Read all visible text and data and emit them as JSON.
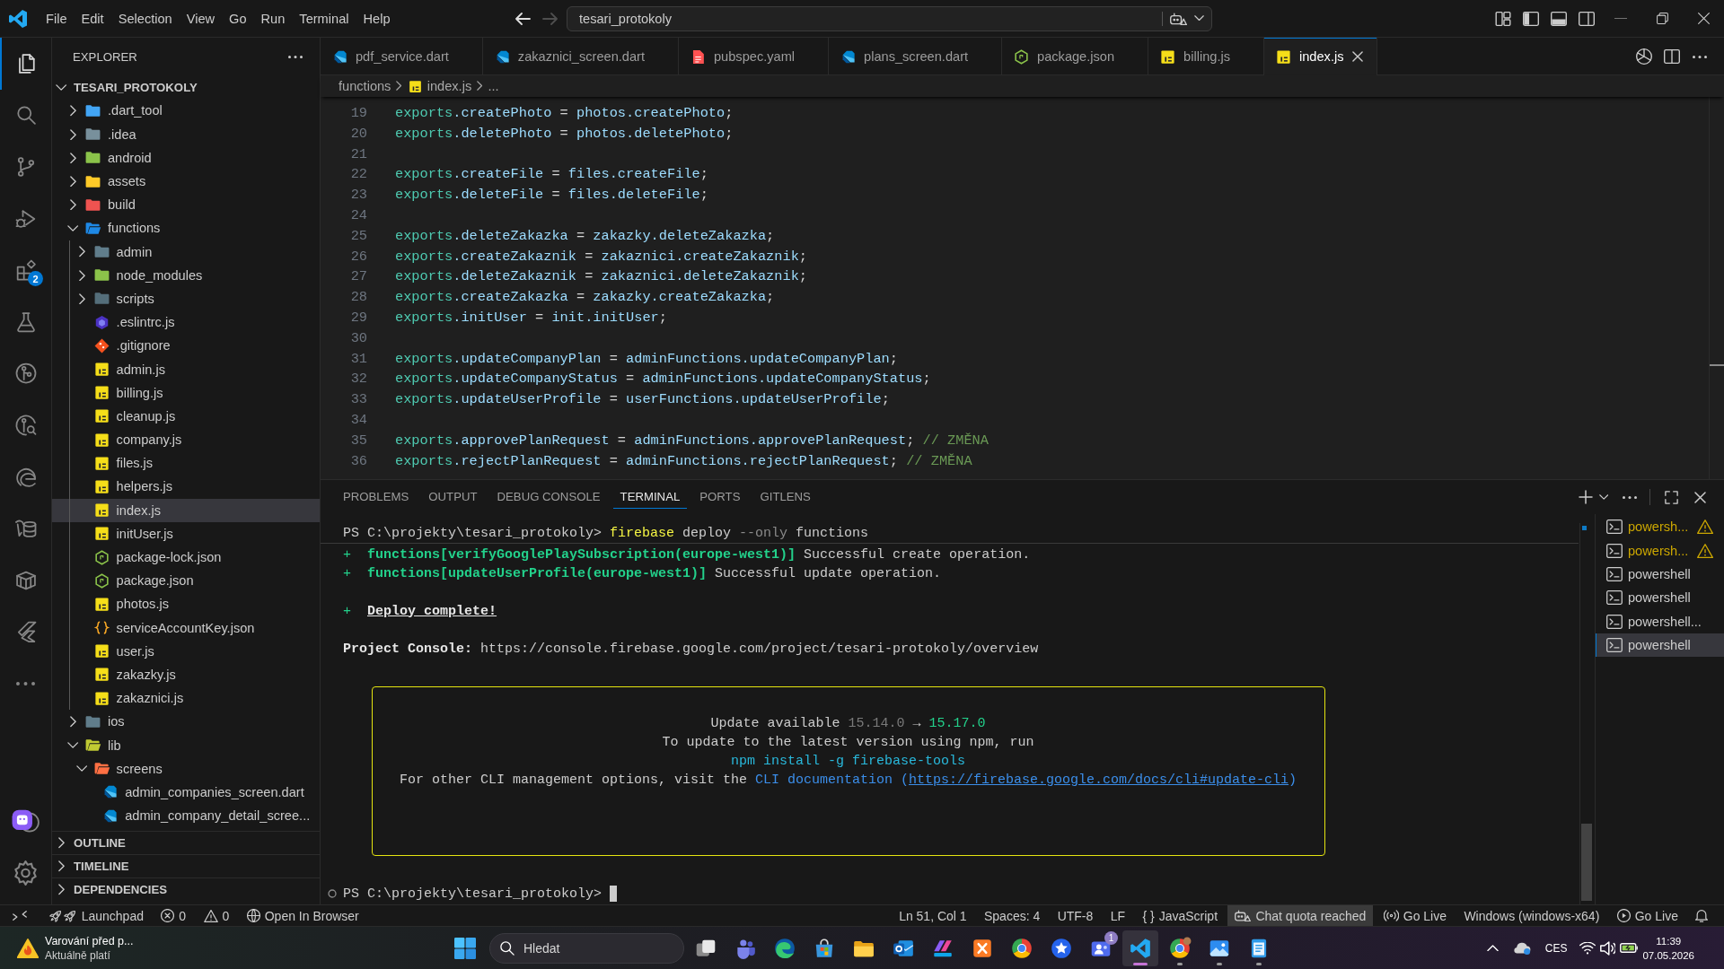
{
  "window": {
    "menu": [
      "File",
      "Edit",
      "Selection",
      "View",
      "Go",
      "Run",
      "Terminal",
      "Help"
    ],
    "navigation": [
      {
        "disabled": false
      },
      {
        "disabled": true
      }
    ],
    "command_center": {
      "label": "tesari_protokoly"
    },
    "layout_controls": [
      {
        "kind": "customize"
      },
      {
        "kind": "primary-sidebar",
        "on": true
      },
      {
        "kind": "panel",
        "on": true
      },
      {
        "kind": "secondary-sidebar",
        "on": false
      }
    ]
  },
  "activity_bar": {
    "items": [
      {
        "selected": true
      },
      {
        "selected": false
      },
      {
        "selected": false
      },
      {
        "selected": false
      },
      {
        "selected": false,
        "badge": "2"
      },
      {
        "selected": false
      },
      {
        "selected": false
      },
      {
        "selected": false
      },
      {
        "selected": false
      },
      {
        "selected": false
      },
      {
        "selected": false
      },
      {
        "selected": false
      },
      {
        "selected": false
      }
    ]
  },
  "explorer": {
    "title": "EXPLORER",
    "root": {
      "label": "TESARI_PROTOKOLY",
      "expanded": true
    },
    "items": [
      {
        "label": ".dart_tool",
        "kind": "folder",
        "color": "#42a5f5",
        "expanded": false,
        "selected": false
      },
      {
        "label": ".idea",
        "kind": "folder",
        "color": "#78909c",
        "expanded": false,
        "selected": false
      },
      {
        "label": "android",
        "kind": "folder",
        "color": "#8bc34a",
        "expanded": false,
        "selected": false
      },
      {
        "label": "assets",
        "kind": "folder",
        "color": "#ffca28",
        "expanded": false,
        "selected": false
      },
      {
        "label": "build",
        "kind": "folder",
        "color": "#ef5350",
        "expanded": false,
        "selected": false
      },
      {
        "label": "functions",
        "kind": "folder",
        "color": "#1e88e5",
        "expanded": true,
        "selected": false,
        "children": [
          {
            "label": "admin",
            "kind": "folder",
            "color": "#607d8b",
            "expanded": false,
            "selected": false
          },
          {
            "label": "node_modules",
            "kind": "folder",
            "color": "#8bc34a",
            "expanded": false,
            "selected": false
          },
          {
            "label": "scripts",
            "kind": "folder",
            "color": "#546e7a",
            "expanded": false,
            "selected": false
          },
          {
            "label": ".eslintrc.js",
            "kind": "eslint",
            "selected": false
          },
          {
            "label": ".gitignore",
            "kind": "git",
            "selected": false
          },
          {
            "label": "admin.js",
            "kind": "js",
            "selected": false
          },
          {
            "label": "billing.js",
            "kind": "js",
            "selected": false
          },
          {
            "label": "cleanup.js",
            "kind": "js",
            "selected": false
          },
          {
            "label": "company.js",
            "kind": "js",
            "selected": false
          },
          {
            "label": "files.js",
            "kind": "js",
            "selected": false
          },
          {
            "label": "helpers.js",
            "kind": "js",
            "selected": false
          },
          {
            "label": "index.js",
            "kind": "js",
            "selected": true
          },
          {
            "label": "initUser.js",
            "kind": "js",
            "selected": false
          },
          {
            "label": "package-lock.json",
            "kind": "npm",
            "selected": false
          },
          {
            "label": "package.json",
            "kind": "npm",
            "selected": false
          },
          {
            "label": "photos.js",
            "kind": "js",
            "selected": false
          },
          {
            "label": "serviceAccountKey.json",
            "kind": "json",
            "selected": false
          },
          {
            "label": "user.js",
            "kind": "js",
            "selected": false
          },
          {
            "label": "zakazky.js",
            "kind": "js",
            "selected": false
          },
          {
            "label": "zakaznici.js",
            "kind": "js",
            "selected": false
          }
        ]
      },
      {
        "label": "ios",
        "kind": "folder",
        "color": "#607d8b",
        "expanded": false,
        "selected": false
      },
      {
        "label": "lib",
        "kind": "folder",
        "color": "#c0ca33",
        "expanded": true,
        "selected": false,
        "children": [
          {
            "label": "screens",
            "kind": "folder",
            "color": "#ff7043",
            "expanded": true,
            "selected": false,
            "children": [
              {
                "label": "admin_companies_screen.dart",
                "kind": "dart",
                "selected": false
              },
              {
                "label": "admin_company_detail_scree...",
                "kind": "dart",
                "selected": false
              }
            ]
          }
        ]
      }
    ],
    "sections": [
      {
        "label": "OUTLINE",
        "expanded": false
      },
      {
        "label": "TIMELINE",
        "expanded": false
      },
      {
        "label": "DEPENDENCIES",
        "expanded": false
      }
    ]
  },
  "editor": {
    "tabs": [
      {
        "label": "pdf_service.dart",
        "kind": "dart",
        "selected": false
      },
      {
        "label": "zakaznici_screen.dart",
        "kind": "dart",
        "selected": false
      },
      {
        "label": "pubspec.yaml",
        "kind": "yaml",
        "selected": false
      },
      {
        "label": "plans_screen.dart",
        "kind": "dart",
        "selected": false
      },
      {
        "label": "package.json",
        "kind": "npm",
        "selected": false
      },
      {
        "label": "billing.js",
        "kind": "js",
        "selected": false
      },
      {
        "label": "index.js",
        "kind": "js",
        "selected": true
      }
    ],
    "breadcrumb": [
      {
        "label": "functions"
      },
      {
        "label": "index.js",
        "kind": "js"
      },
      {
        "label": "..."
      }
    ],
    "lines": [
      {
        "number": "19",
        "segments": [
          {
            "text": "exports",
            "kind": "object"
          },
          {
            "text": ".createPhoto",
            "kind": "member"
          },
          {
            "text": " = ",
            "kind": "op"
          },
          {
            "text": "photos.createPhoto",
            "kind": "member"
          },
          {
            "text": ";",
            "kind": "op"
          }
        ]
      },
      {
        "number": "20",
        "segments": [
          {
            "text": "exports",
            "kind": "object"
          },
          {
            "text": ".deletePhoto",
            "kind": "member"
          },
          {
            "text": " = ",
            "kind": "op"
          },
          {
            "text": "photos.deletePhoto",
            "kind": "member"
          },
          {
            "text": ";",
            "kind": "op"
          }
        ]
      },
      {
        "number": "21"
      },
      {
        "number": "22",
        "segments": [
          {
            "text": "exports",
            "kind": "object"
          },
          {
            "text": ".createFile",
            "kind": "member"
          },
          {
            "text": " = ",
            "kind": "op"
          },
          {
            "text": "files.createFile",
            "kind": "member"
          },
          {
            "text": ";",
            "kind": "op"
          }
        ]
      },
      {
        "number": "23",
        "segments": [
          {
            "text": "exports",
            "kind": "object"
          },
          {
            "text": ".deleteFile",
            "kind": "member"
          },
          {
            "text": " = ",
            "kind": "op"
          },
          {
            "text": "files.deleteFile",
            "kind": "member"
          },
          {
            "text": ";",
            "kind": "op"
          }
        ]
      },
      {
        "number": "24"
      },
      {
        "number": "25",
        "segments": [
          {
            "text": "exports",
            "kind": "object"
          },
          {
            "text": ".deleteZakazka",
            "kind": "member"
          },
          {
            "text": " = ",
            "kind": "op"
          },
          {
            "text": "zakazky.deleteZakazka",
            "kind": "member"
          },
          {
            "text": ";",
            "kind": "op"
          }
        ]
      },
      {
        "number": "26",
        "segments": [
          {
            "text": "exports",
            "kind": "object"
          },
          {
            "text": ".createZakaznik",
            "kind": "member"
          },
          {
            "text": " = ",
            "kind": "op"
          },
          {
            "text": "zakaznici.createZakaznik",
            "kind": "member"
          },
          {
            "text": ";",
            "kind": "op"
          }
        ]
      },
      {
        "number": "27",
        "segments": [
          {
            "text": "exports",
            "kind": "object"
          },
          {
            "text": ".deleteZakaznik",
            "kind": "member"
          },
          {
            "text": " = ",
            "kind": "op"
          },
          {
            "text": "zakaznici.deleteZakaznik",
            "kind": "member"
          },
          {
            "text": ";",
            "kind": "op"
          }
        ]
      },
      {
        "number": "28",
        "segments": [
          {
            "text": "exports",
            "kind": "object"
          },
          {
            "text": ".createZakazka",
            "kind": "member"
          },
          {
            "text": " = ",
            "kind": "op"
          },
          {
            "text": "zakazky.createZakazka",
            "kind": "member"
          },
          {
            "text": ";",
            "kind": "op"
          }
        ]
      },
      {
        "number": "29",
        "segments": [
          {
            "text": "exports",
            "kind": "object"
          },
          {
            "text": ".initUser",
            "kind": "member"
          },
          {
            "text": " = ",
            "kind": "op"
          },
          {
            "text": "init.initUser",
            "kind": "member"
          },
          {
            "text": ";",
            "kind": "op"
          }
        ]
      },
      {
        "number": "30"
      },
      {
        "number": "31",
        "segments": [
          {
            "text": "exports",
            "kind": "object"
          },
          {
            "text": ".updateCompanyPlan",
            "kind": "member"
          },
          {
            "text": " = ",
            "kind": "op"
          },
          {
            "text": "adminFunctions.updateCompanyPlan",
            "kind": "member"
          },
          {
            "text": ";",
            "kind": "op"
          }
        ]
      },
      {
        "number": "32",
        "segments": [
          {
            "text": "exports",
            "kind": "object"
          },
          {
            "text": ".updateCompanyStatus",
            "kind": "member"
          },
          {
            "text": " = ",
            "kind": "op"
          },
          {
            "text": "adminFunctions.updateCompanyStatus",
            "kind": "member"
          },
          {
            "text": ";",
            "kind": "op"
          }
        ]
      },
      {
        "number": "33",
        "segments": [
          {
            "text": "exports",
            "kind": "object"
          },
          {
            "text": ".updateUserProfile",
            "kind": "member"
          },
          {
            "text": " = ",
            "kind": "op"
          },
          {
            "text": "userFunctions.updateUserProfile",
            "kind": "member"
          },
          {
            "text": ";",
            "kind": "op"
          }
        ]
      },
      {
        "number": "34"
      },
      {
        "number": "35",
        "segments": [
          {
            "text": "exports",
            "kind": "object"
          },
          {
            "text": ".approvePlanRequest",
            "kind": "member"
          },
          {
            "text": " = ",
            "kind": "op"
          },
          {
            "text": "adminFunctions.approvePlanRequest",
            "kind": "member"
          },
          {
            "text": ";",
            "kind": "op"
          },
          {
            "text": " // ZMĚNA",
            "kind": "comment"
          }
        ]
      },
      {
        "number": "36",
        "segments": [
          {
            "text": "exports",
            "kind": "object"
          },
          {
            "text": ".rejectPlanRequest",
            "kind": "member"
          },
          {
            "text": " = ",
            "kind": "op"
          },
          {
            "text": "adminFunctions.rejectPlanRequest",
            "kind": "member"
          },
          {
            "text": ";",
            "kind": "op"
          },
          {
            "text": " // ZMĚNA",
            "kind": "comment"
          }
        ]
      }
    ]
  },
  "panel": {
    "tabs": [
      {
        "label": "PROBLEMS",
        "selected": false
      },
      {
        "label": "OUTPUT",
        "selected": false
      },
      {
        "label": "DEBUG CONSOLE",
        "selected": false
      },
      {
        "label": "TERMINAL",
        "selected": true
      },
      {
        "label": "PORTS",
        "selected": false
      },
      {
        "label": "GITLENS",
        "selected": false
      }
    ],
    "terminal": {
      "sticky": [
        {
          "text": "PS C:\\projekty\\tesari_protokoly> ",
          "kind": "plain"
        },
        {
          "text": "firebase",
          "kind": "command"
        },
        {
          "text": " deploy ",
          "kind": "plain"
        },
        {
          "text": "--only",
          "kind": "flag"
        },
        {
          "text": " functions",
          "kind": "plain"
        }
      ],
      "blocks": [
        {
          "kind": "lines",
          "lines": [
            [
              {
                "text": "+  ",
                "kind": "success"
              },
              {
                "text": "functions[verifyGooglePlaySubscription(europe-west1)]",
                "kind": "success-bold"
              },
              {
                "text": " Successful create operation.",
                "kind": "plain"
              }
            ],
            [
              {
                "text": "+  ",
                "kind": "success"
              },
              {
                "text": "functions[updateUserProfile(europe-west1)]",
                "kind": "success-bold"
              },
              {
                "text": " Successful update operation.",
                "kind": "plain"
              }
            ]
          ]
        },
        {
          "kind": "lines",
          "lines": [
            [
              {
                "text": "+  ",
                "kind": "success"
              },
              {
                "text": "Deploy complete!",
                "kind": "heading"
              }
            ]
          ]
        },
        {
          "kind": "lines",
          "lines": [
            [
              {
                "text": "Project Console:",
                "kind": "label"
              },
              {
                "text": " https://console.firebase.google.com/project/tesari-protokoly/overview",
                "kind": "plain"
              }
            ]
          ]
        },
        {
          "kind": "notice",
          "lines": [
            [
              {
                "text": "Update available ",
                "kind": "plain"
              },
              {
                "text": "15.14.0",
                "kind": "muted"
              },
              {
                "text": " → ",
                "kind": "plain"
              },
              {
                "text": "15.17.0",
                "kind": "success"
              }
            ],
            [
              {
                "text": "To update to the latest version using npm, run",
                "kind": "plain"
              }
            ],
            [
              {
                "text": "npm install -g firebase-tools",
                "kind": "code"
              }
            ],
            [
              {
                "text": "For other CLI management options, visit the ",
                "kind": "plain"
              },
              {
                "text": "CLI documentation (",
                "kind": "link"
              },
              {
                "text": "https://firebase.google.com/docs/cli#update-cli",
                "kind": "url"
              },
              {
                "text": ")",
                "kind": "link"
              }
            ]
          ]
        }
      ],
      "prompt": "PS C:\\projekty\\tesari_protokoly> "
    },
    "terminals": [
      {
        "label": "powersh...",
        "warning": true,
        "selected": false
      },
      {
        "label": "powersh...",
        "warning": true,
        "selected": false
      },
      {
        "label": "powershell",
        "warning": false,
        "selected": false
      },
      {
        "label": "powershell",
        "warning": false,
        "selected": false
      },
      {
        "label": "powershell...",
        "warning": false,
        "selected": false
      },
      {
        "label": "powershell",
        "warning": false,
        "selected": true
      }
    ]
  },
  "status_bar": {
    "left": [
      {
        "kind": "remote"
      },
      {
        "kind": "launchpad",
        "text": "Launchpad"
      },
      {
        "kind": "problems",
        "errors": "0",
        "warnings": "0"
      },
      {
        "kind": "browser",
        "text": "Open In Browser"
      }
    ],
    "right": [
      {
        "kind": "plain",
        "text": "Ln 51, Col 1"
      },
      {
        "kind": "plain",
        "text": "Spaces: 4"
      },
      {
        "kind": "plain",
        "text": "UTF-8"
      },
      {
        "kind": "plain",
        "text": "LF"
      },
      {
        "kind": "language",
        "icon": "{ }",
        "text": "JavaScript"
      },
      {
        "kind": "quota",
        "text": "Chat quota reached"
      },
      {
        "kind": "live",
        "text": "Go Live"
      },
      {
        "kind": "plain",
        "text": "Windows (windows-x64)"
      },
      {
        "kind": "play",
        "text": "Go Live"
      },
      {
        "kind": "bell"
      }
    ]
  },
  "taskbar": {
    "widget": {
      "title": "Varování před p...",
      "subtitle": "Aktuálně platí"
    },
    "search": {
      "placeholder": "Hledat"
    },
    "apps": [
      {
        "selected": false,
        "running": false
      },
      {
        "selected": false,
        "running": false
      },
      {
        "selected": false,
        "running": false
      },
      {
        "selected": false,
        "running": false
      },
      {
        "selected": false,
        "running": false
      },
      {
        "selected": false,
        "running": false
      },
      {
        "selected": false,
        "running": false
      },
      {
        "selected": false,
        "running": false
      },
      {
        "selected": false,
        "running": false
      },
      {
        "selected": false,
        "running": false
      },
      {
        "selected": false,
        "running": false,
        "badge": "1"
      },
      {
        "selected": true,
        "running": true
      },
      {
        "selected": false,
        "running": true
      },
      {
        "selected": false,
        "running": true
      },
      {
        "selected": false,
        "running": true
      }
    ],
    "tray": {
      "language": "CES",
      "time": "11:39",
      "date": "07.05.2026"
    }
  }
}
